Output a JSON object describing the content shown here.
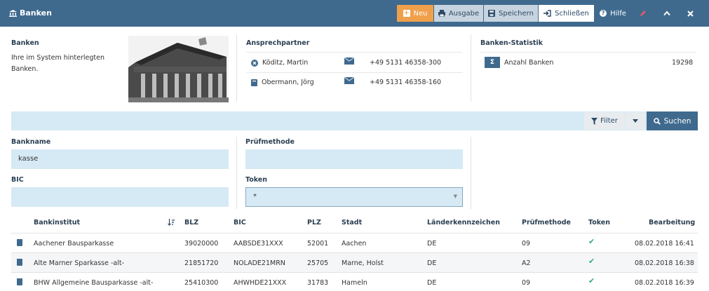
{
  "header": {
    "title": "Banken",
    "buttons": {
      "new": "Neu",
      "output": "Ausgabe",
      "save": "Speichern",
      "close": "Schließen",
      "help": "Hilfe"
    }
  },
  "info": {
    "title": "Banken",
    "description": "Ihre im System hinterlegten Banken.",
    "contacts_title": "Ansprechpartner",
    "contacts": [
      {
        "name": "Köditz, Martin",
        "phone": "+49 5131 46358-300"
      },
      {
        "name": "Obermann, Jörg",
        "phone": "+49 5131 46358-160"
      }
    ],
    "stats_title": "Banken-Statistik",
    "stats": [
      {
        "label": "Anzahl Banken",
        "value": "19298",
        "badge": "Σ"
      }
    ]
  },
  "search": {
    "filter_label": "Filter",
    "search_label": "Suchen"
  },
  "form": {
    "bankname_label": "Bankname",
    "bankname_value": "kasse",
    "bic_label": "BIC",
    "bic_value": "",
    "pruefmethode_label": "Prüfmethode",
    "pruefmethode_value": "",
    "token_label": "Token",
    "token_value": "*"
  },
  "table": {
    "columns": [
      "Bankinstitut",
      "BLZ",
      "BIC",
      "PLZ",
      "Stadt",
      "Länderkennzeichen",
      "Prüfmethode",
      "Token",
      "Bearbeitung"
    ],
    "rows": [
      {
        "bank": "Aachener Bausparkasse",
        "blz": "39020000",
        "bic": "AABSDE31XXX",
        "plz": "52001",
        "city": "Aachen",
        "country": "DE",
        "method": "09",
        "edited": "08.02.2018 16:41"
      },
      {
        "bank": "Alte Marner Sparkasse -alt-",
        "blz": "21851720",
        "bic": "NOLADE21MRN",
        "plz": "25705",
        "city": "Marne, Holst",
        "country": "DE",
        "method": "A2",
        "edited": "08.02.2018 16:38"
      },
      {
        "bank": "BHW Allgemeine Bausparkasse -alt-",
        "blz": "25410300",
        "bic": "AHWHDE21XXX",
        "plz": "31783",
        "city": "Hameln",
        "country": "DE",
        "method": "09",
        "edited": "08.02.2018 16:39"
      }
    ]
  },
  "colors": {
    "header": "#3f6a8e",
    "accent_new": "#f0a04b",
    "input_bg": "#d6eaf5",
    "check": "#3aaa80"
  }
}
